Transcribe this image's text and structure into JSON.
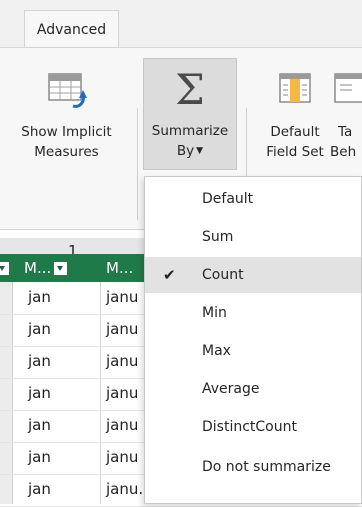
{
  "ribbon_tab": "Advanced",
  "ribbon": {
    "implicit": {
      "line1": "Show Implicit",
      "line2": "Measures"
    },
    "summarize": {
      "line1": "Summarize",
      "line2": "By"
    },
    "default_field": {
      "line1": "Default",
      "line2": "Field Set"
    },
    "table_behavior": {
      "line1": "Ta",
      "line2": "Beh"
    }
  },
  "formula_bar": {
    "value": "1"
  },
  "grid": {
    "headers": [
      "M...",
      "M..."
    ],
    "rows": [
      {
        "a": "jan",
        "b": "janu"
      },
      {
        "a": "jan",
        "b": "janu"
      },
      {
        "a": "jan",
        "b": "janu"
      },
      {
        "a": "jan",
        "b": "janu"
      },
      {
        "a": "jan",
        "b": "janu"
      },
      {
        "a": "jan",
        "b": "janu"
      },
      {
        "a": "jan",
        "b": "janu..."
      }
    ]
  },
  "summarize_menu": {
    "items": [
      {
        "label": "Default",
        "checked": false
      },
      {
        "label": "Sum",
        "checked": false
      },
      {
        "label": "Count",
        "checked": true
      },
      {
        "label": "Min",
        "checked": false
      },
      {
        "label": "Max",
        "checked": false
      },
      {
        "label": "Average",
        "checked": false
      },
      {
        "label": "DistinctCount",
        "checked": false
      },
      {
        "label": "Do not summarize",
        "checked": false
      }
    ],
    "check_glyph": "✔"
  },
  "colors": {
    "grid_header": "#1f7a4a",
    "ribbon_bg": "#f7f7f7",
    "menu_highlight": "#e2e2e2"
  }
}
